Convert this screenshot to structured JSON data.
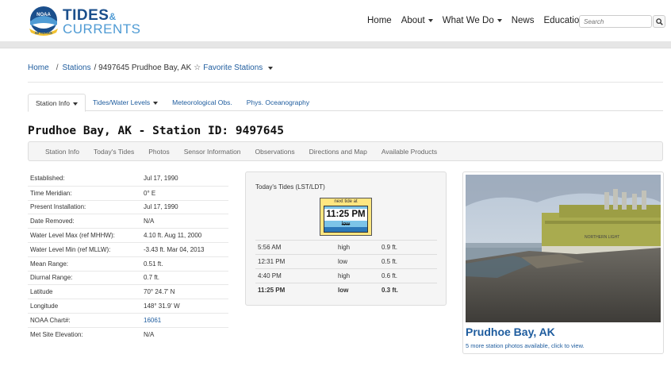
{
  "header": {
    "logo_badge": "NOAA",
    "logo_ring": "50 YEARS",
    "logo_tides": "TIDES",
    "logo_amp": "&",
    "logo_currents": "CURRENTS",
    "nav": [
      {
        "label": "Home",
        "dropdown": false
      },
      {
        "label": "About",
        "dropdown": true
      },
      {
        "label": "What We Do",
        "dropdown": true
      },
      {
        "label": "News",
        "dropdown": false
      },
      {
        "label": "Education",
        "dropdown": true
      }
    ],
    "search_placeholder": "Search"
  },
  "breadcrumb": {
    "home": "Home",
    "sep": "/",
    "stations": "Stations",
    "current": "/ 9497645 Prudhoe Bay, AK",
    "favorite": "Favorite Stations"
  },
  "tabs": [
    {
      "label": "Station Info",
      "dropdown": true,
      "active": true
    },
    {
      "label": "Tides/Water Levels",
      "dropdown": true,
      "active": false
    },
    {
      "label": "Meteorological Obs.",
      "dropdown": false,
      "active": false
    },
    {
      "label": "Phys. Oceanography",
      "dropdown": false,
      "active": false
    }
  ],
  "station_title": "Prudhoe Bay, AK - Station ID: 9497645",
  "subnav": [
    "Station Info",
    "Today's Tides",
    "Photos",
    "Sensor Information",
    "Observations",
    "Directions and Map",
    "Available Products"
  ],
  "info_rows": [
    {
      "label": "Established:",
      "value": "Jul 17, 1990"
    },
    {
      "label": "Time Meridian:",
      "value": "0° E"
    },
    {
      "label": "Present Installation:",
      "value": "Jul 17, 1990"
    },
    {
      "label": "Date Removed:",
      "value": "N/A"
    },
    {
      "label": "Water Level Max (ref MHHW):",
      "value": "4.10 ft. Aug 11, 2000"
    },
    {
      "label": "Water Level Min (ref MLLW):",
      "value": "-3.43 ft. Mar 04, 2013"
    },
    {
      "label": "Mean Range:",
      "value": "0.51 ft."
    },
    {
      "label": "Diurnal Range:",
      "value": "0.7 ft."
    },
    {
      "label": "Latitude",
      "value": "70° 24.7' N"
    },
    {
      "label": "Longitude",
      "value": "148° 31.9' W"
    },
    {
      "label": "NOAA Chart#:",
      "value": "16061"
    },
    {
      "label": "Met Site Elevation:",
      "value": "N/A"
    }
  ],
  "tides": {
    "title": "Today's Tides (LST/LDT)",
    "next_label": "next tide at",
    "next_time": "11:25 PM",
    "next_state": "low",
    "rows": [
      {
        "time": "5:56 AM",
        "type": "high",
        "height": "0.9 ft."
      },
      {
        "time": "12:31 PM",
        "type": "low",
        "height": "0.5 ft."
      },
      {
        "time": "4:40 PM",
        "type": "high",
        "height": "0.6 ft."
      },
      {
        "time": "11:25 PM",
        "type": "low",
        "height": "0.3 ft."
      }
    ]
  },
  "photo": {
    "sign_text": "NORTHERN LIGHT",
    "name": "Prudhoe Bay, AK",
    "more": "5 more station photos available, click to view."
  },
  "colors": {
    "link": "#1e5c9e",
    "brand": "#1b4f8c",
    "accent": "#4f9bd4"
  }
}
